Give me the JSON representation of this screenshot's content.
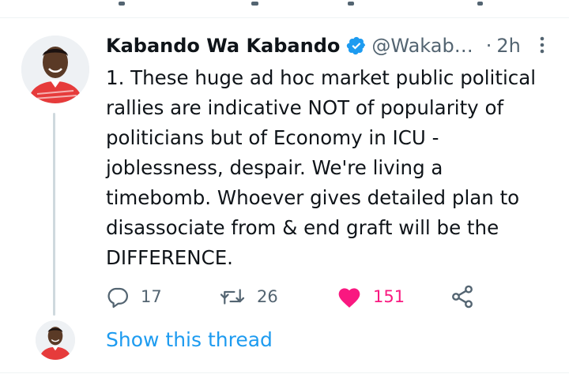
{
  "tweet": {
    "author_name": "Kabando Wa Kabando",
    "handle": "@Wakab…",
    "dot": "·",
    "time": "2h",
    "text": "1. These huge ad hoc market public political\nrallies are indicative NOT of popularity of\npoliticians but of Economy in ICU -\njoblessness, despair. We're living a\ntimebomb. Whoever gives detailed plan to\ndisassociate from & end graft will be the\nDIFFERENCE.",
    "reply_count": "17",
    "retweet_count": "26",
    "like_count": "151",
    "liked": true
  },
  "thread": {
    "show_label": "Show this thread"
  },
  "icons": {
    "verified": "verified-badge-icon",
    "more": "more-vertical-icon",
    "reply": "reply-icon",
    "retweet": "retweet-icon",
    "like": "heart-icon",
    "share": "share-icon"
  },
  "colors": {
    "accent_blue": "#1d9bf0",
    "like_pink": "#f91880",
    "secondary_text": "#536471",
    "primary_text": "#0f1419",
    "thread_line": "#cfd9de"
  }
}
